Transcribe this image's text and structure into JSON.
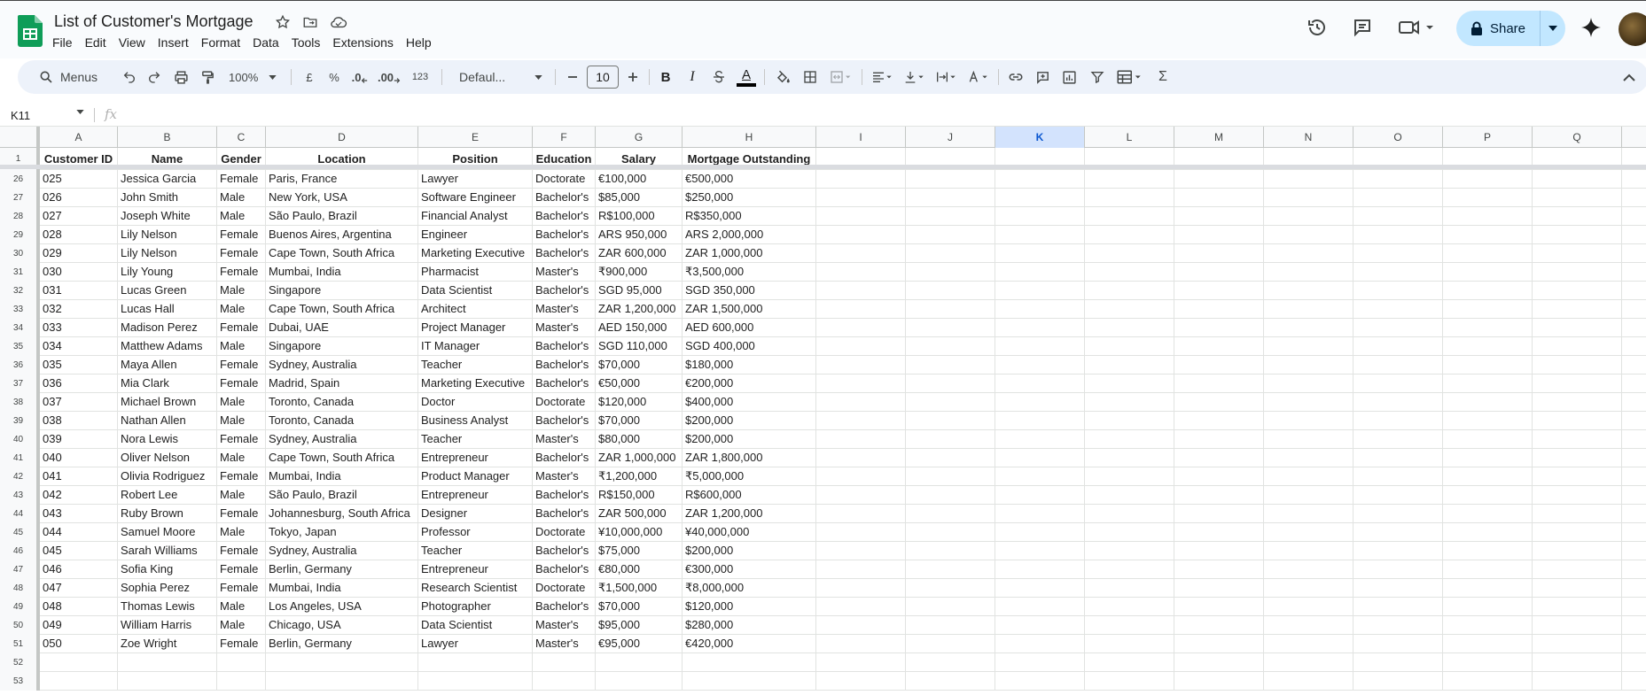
{
  "app": {
    "doc_title": "List of Customer's Mortgage",
    "menus": [
      "File",
      "Edit",
      "View",
      "Insert",
      "Format",
      "Data",
      "Tools",
      "Extensions",
      "Help"
    ],
    "share_label": "Share"
  },
  "toolbar": {
    "search_label": "Menus",
    "zoom": "100%",
    "currency": "£",
    "percent": "%",
    "dec_decrease": ".0",
    "dec_increase": ".00",
    "number_format": "123",
    "font": "Defaul...",
    "font_size": "10",
    "bold": "B",
    "italic": "I",
    "text_color": "A",
    "functions": "Σ"
  },
  "formula_bar": {
    "cell_ref": "K11",
    "fx": "fx"
  },
  "columns": [
    "A",
    "B",
    "C",
    "D",
    "E",
    "F",
    "G",
    "H",
    "I",
    "J",
    "K",
    "L",
    "M",
    "N",
    "O",
    "P",
    "Q"
  ],
  "selected_column": "K",
  "header_row": {
    "num": "1",
    "cells": [
      "Customer ID",
      "Name",
      "Gender",
      "Location",
      "Position",
      "Education",
      "Salary",
      "Mortgage Outstanding"
    ]
  },
  "rows": [
    {
      "num": "26",
      "cells": [
        "025",
        "Jessica Garcia",
        "Female",
        "Paris, France",
        "Lawyer",
        "Doctorate",
        "€100,000",
        "€500,000"
      ]
    },
    {
      "num": "27",
      "cells": [
        "026",
        "John Smith",
        "Male",
        "New York, USA",
        "Software Engineer",
        "Bachelor's",
        "$85,000",
        "$250,000"
      ]
    },
    {
      "num": "28",
      "cells": [
        "027",
        "Joseph White",
        "Male",
        "São Paulo, Brazil",
        "Financial Analyst",
        "Bachelor's",
        "R$100,000",
        "R$350,000"
      ]
    },
    {
      "num": "29",
      "cells": [
        "028",
        "Lily Nelson",
        "Female",
        "Buenos Aires, Argentina",
        "Engineer",
        "Bachelor's",
        "ARS 950,000",
        "ARS 2,000,000"
      ]
    },
    {
      "num": "30",
      "cells": [
        "029",
        "Lily Nelson",
        "Female",
        "Cape Town, South Africa",
        "Marketing Executive",
        "Bachelor's",
        "ZAR 600,000",
        "ZAR 1,000,000"
      ]
    },
    {
      "num": "31",
      "cells": [
        "030",
        "Lily Young",
        "Female",
        "Mumbai, India",
        "Pharmacist",
        "Master's",
        "₹900,000",
        "₹3,500,000"
      ]
    },
    {
      "num": "32",
      "cells": [
        "031",
        "Lucas Green",
        "Male",
        "Singapore",
        "Data Scientist",
        "Bachelor's",
        "SGD 95,000",
        "SGD 350,000"
      ]
    },
    {
      "num": "33",
      "cells": [
        "032",
        "Lucas Hall",
        "Male",
        "Cape Town, South Africa",
        "Architect",
        "Master's",
        "ZAR 1,200,000",
        "ZAR 1,500,000"
      ]
    },
    {
      "num": "34",
      "cells": [
        "033",
        "Madison Perez",
        "Female",
        "Dubai, UAE",
        "Project Manager",
        "Master's",
        "AED 150,000",
        "AED 600,000"
      ]
    },
    {
      "num": "35",
      "cells": [
        "034",
        "Matthew Adams",
        "Male",
        "Singapore",
        "IT Manager",
        "Bachelor's",
        "SGD 110,000",
        "SGD 400,000"
      ]
    },
    {
      "num": "36",
      "cells": [
        "035",
        "Maya Allen",
        "Female",
        "Sydney, Australia",
        "Teacher",
        "Bachelor's",
        "$70,000",
        "$180,000"
      ]
    },
    {
      "num": "37",
      "cells": [
        "036",
        "Mia Clark",
        "Female",
        "Madrid, Spain",
        "Marketing Executive",
        "Bachelor's",
        "€50,000",
        "€200,000"
      ]
    },
    {
      "num": "38",
      "cells": [
        "037",
        "Michael Brown",
        "Male",
        "Toronto, Canada",
        "Doctor",
        "Doctorate",
        "$120,000",
        "$400,000"
      ]
    },
    {
      "num": "39",
      "cells": [
        "038",
        "Nathan Allen",
        "Male",
        "Toronto, Canada",
        "Business Analyst",
        "Bachelor's",
        "$70,000",
        "$200,000"
      ]
    },
    {
      "num": "40",
      "cells": [
        "039",
        "Nora Lewis",
        "Female",
        "Sydney, Australia",
        "Teacher",
        "Master's",
        "$80,000",
        "$200,000"
      ]
    },
    {
      "num": "41",
      "cells": [
        "040",
        "Oliver Nelson",
        "Male",
        "Cape Town, South Africa",
        "Entrepreneur",
        "Bachelor's",
        "ZAR 1,000,000",
        "ZAR 1,800,000"
      ]
    },
    {
      "num": "42",
      "cells": [
        "041",
        "Olivia Rodriguez",
        "Female",
        "Mumbai, India",
        "Product Manager",
        "Master's",
        "₹1,200,000",
        "₹5,000,000"
      ]
    },
    {
      "num": "43",
      "cells": [
        "042",
        "Robert Lee",
        "Male",
        "São Paulo, Brazil",
        "Entrepreneur",
        "Bachelor's",
        "R$150,000",
        "R$600,000"
      ]
    },
    {
      "num": "44",
      "cells": [
        "043",
        "Ruby Brown",
        "Female",
        "Johannesburg, South Africa",
        "Designer",
        "Bachelor's",
        "ZAR 500,000",
        "ZAR 1,200,000"
      ]
    },
    {
      "num": "45",
      "cells": [
        "044",
        "Samuel Moore",
        "Male",
        "Tokyo, Japan",
        "Professor",
        "Doctorate",
        "¥10,000,000",
        "¥40,000,000"
      ]
    },
    {
      "num": "46",
      "cells": [
        "045",
        "Sarah Williams",
        "Female",
        "Sydney, Australia",
        "Teacher",
        "Bachelor's",
        "$75,000",
        "$200,000"
      ]
    },
    {
      "num": "47",
      "cells": [
        "046",
        "Sofia King",
        "Female",
        "Berlin, Germany",
        "Entrepreneur",
        "Bachelor's",
        "€80,000",
        "€300,000"
      ]
    },
    {
      "num": "48",
      "cells": [
        "047",
        "Sophia Perez",
        "Female",
        "Mumbai, India",
        "Research Scientist",
        "Doctorate",
        "₹1,500,000",
        "₹8,000,000"
      ]
    },
    {
      "num": "49",
      "cells": [
        "048",
        "Thomas Lewis",
        "Male",
        "Los Angeles, USA",
        "Photographer",
        "Bachelor's",
        "$70,000",
        "$120,000"
      ]
    },
    {
      "num": "50",
      "cells": [
        "049",
        "William Harris",
        "Male",
        "Chicago, USA",
        "Data Scientist",
        "Master's",
        "$95,000",
        "$280,000"
      ]
    },
    {
      "num": "51",
      "cells": [
        "050",
        "Zoe Wright",
        "Female",
        "Berlin, Germany",
        "Lawyer",
        "Master's",
        "€95,000",
        "€420,000"
      ]
    },
    {
      "num": "52",
      "cells": [
        "",
        "",
        "",
        "",
        "",
        "",
        "",
        ""
      ]
    },
    {
      "num": "53",
      "cells": [
        "",
        "",
        "",
        "",
        "",
        "",
        "",
        ""
      ]
    }
  ],
  "colors": {
    "accent": "#0b57d0",
    "share_bg": "#c2e7ff",
    "toolbar_bg": "#edf2fa",
    "sheets_green": "#0f9d58"
  }
}
